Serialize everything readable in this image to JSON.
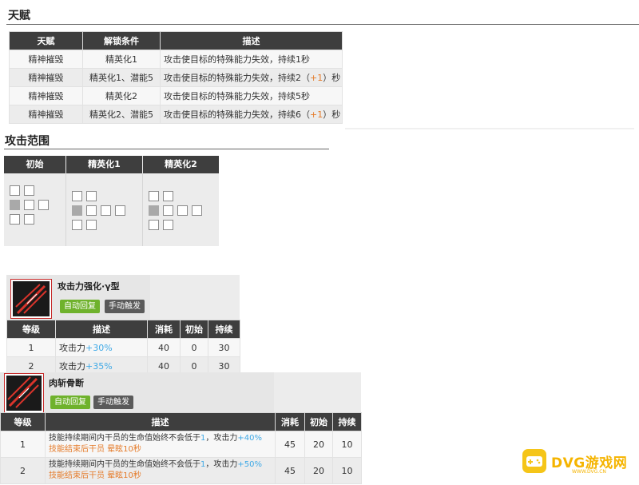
{
  "talent": {
    "title": "天赋",
    "headers": [
      "天赋",
      "解锁条件",
      "描述"
    ],
    "rows": [
      {
        "name": "精神摧毁",
        "condition": "精英化1",
        "desc_pre": "攻击使目标的特殊能力失效，持续1秒",
        "desc_plus": "",
        "desc_post": ""
      },
      {
        "name": "精神摧毁",
        "condition": "精英化1、潜能5",
        "desc_pre": "攻击使目标的特殊能力失效，持续2（",
        "desc_plus": "+1",
        "desc_post": "）秒"
      },
      {
        "name": "精神摧毁",
        "condition": "精英化2",
        "desc_pre": "攻击使目标的特殊能力失效，持续5秒",
        "desc_plus": "",
        "desc_post": ""
      },
      {
        "name": "精神摧毁",
        "condition": "精英化2、潜能5",
        "desc_pre": "攻击使目标的特殊能力失效，持续6（",
        "desc_plus": "+1",
        "desc_post": "）秒"
      }
    ]
  },
  "range": {
    "title": "攻击范围",
    "headers": [
      "初始",
      "精英化1",
      "精英化2"
    ]
  },
  "skill1": {
    "name": "攻击力强化·γ型",
    "recovery": "自动回复",
    "trigger": "手动触发",
    "headers": [
      "等级",
      "描述",
      "消耗",
      "初始",
      "持续"
    ],
    "rows": [
      {
        "level": "1",
        "desc": "攻击力",
        "bonus": "+30%",
        "cost": "40",
        "init": "0",
        "dur": "30"
      },
      {
        "level": "2",
        "desc": "攻击力",
        "bonus": "+35%",
        "cost": "40",
        "init": "0",
        "dur": "30"
      }
    ]
  },
  "skill2": {
    "name": "肉斩骨断",
    "recovery": "自动回复",
    "trigger": "手动触发",
    "headers": [
      "等级",
      "描述",
      "消耗",
      "初始",
      "持续"
    ],
    "rows": [
      {
        "level": "1",
        "line1_pre": "技能持续期间内干员的生命值始终不会低于",
        "line1_num": "1",
        "line1_mid": "，攻击力",
        "line1_bonus": "+40%",
        "line2": "技能结束后干员 晕眩10秒",
        "cost": "45",
        "init": "20",
        "dur": "10"
      },
      {
        "level": "2",
        "line1_pre": "技能持续期间内干员的生命值始终不会低于",
        "line1_num": "1",
        "line1_mid": "，攻击力",
        "line1_bonus": "+50%",
        "line2": "技能结束后干员 晕眩10秒",
        "cost": "45",
        "init": "20",
        "dur": "10"
      }
    ]
  },
  "watermark": {
    "text": "DVG游戏网",
    "sub": "WWW.DVG.CN"
  },
  "colors": {
    "header_bg": "#3e3e3e",
    "plus_orange": "#e57b2a",
    "bonus_blue": "#3fa9e6",
    "auto_green": "#6fb22c",
    "manual_gray": "#5a5a5a",
    "watermark": "#f5b400"
  }
}
